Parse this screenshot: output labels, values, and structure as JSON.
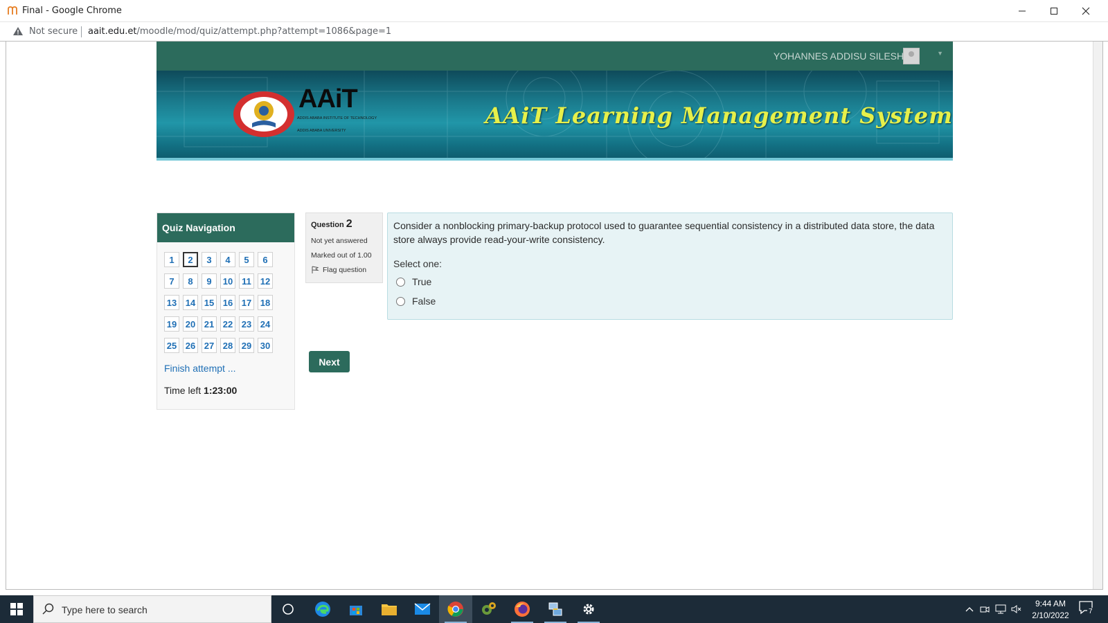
{
  "browser": {
    "window_title": "Final - Google Chrome",
    "security_label": "Not secure",
    "url_host": "aait.edu.et",
    "url_path": "/moodle/mod/quiz/attempt.php?attempt=1086&page=1"
  },
  "header": {
    "username": "YOHANNES ADDISU SILESHI",
    "brand": "AAiT",
    "brand_sub": [
      "ADDIS ABABA INSTITUTE OF TECHNOLOGY",
      "ADDIS ABABA UNIVERSITY"
    ],
    "lms_title": "AAiT Learning Management System"
  },
  "quiz_nav": {
    "title": "Quiz Navigation",
    "current": 2,
    "questions": [
      "1",
      "2",
      "3",
      "4",
      "5",
      "6",
      "7",
      "8",
      "9",
      "10",
      "11",
      "12",
      "13",
      "14",
      "15",
      "16",
      "17",
      "18",
      "19",
      "20",
      "21",
      "22",
      "23",
      "24",
      "25",
      "26",
      "27",
      "28",
      "29",
      "30"
    ],
    "finish_label": "Finish attempt ...",
    "time_label": "Time left",
    "time_value": "1:23:00"
  },
  "question": {
    "label": "Question",
    "number": "2",
    "status": "Not yet answered",
    "marks": "Marked out of 1.00",
    "flag_label": "Flag question",
    "text": "Consider a nonblocking primary-backup protocol used to guarantee sequential consistency  in a distributed data store, the data store always provide read-your-write consistency.",
    "prompt": "Select one:",
    "options": [
      "True",
      "False"
    ]
  },
  "actions": {
    "next_label": "Next"
  },
  "taskbar": {
    "search_placeholder": "Type here to search",
    "time": "9:44 AM",
    "date": "2/10/2022",
    "notification_count": "7"
  },
  "colors": {
    "moodle_green": "#2c6b5c",
    "link_blue": "#1f6fb5",
    "question_bg": "#e7f3f5",
    "lms_title_color": "#e6f04a"
  }
}
